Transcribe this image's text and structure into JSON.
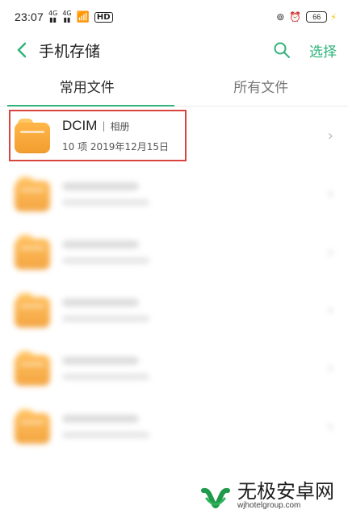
{
  "status_bar": {
    "time": "23:07",
    "signal_1": "4G",
    "signal_2": "4G",
    "network": "HD",
    "battery": "66",
    "icons": [
      "signal-icon",
      "wifi-icon",
      "alarm-icon",
      "lock-icon",
      "charging-icon"
    ]
  },
  "header": {
    "title": "手机存储",
    "select_label": "选择",
    "icons": [
      "back-icon",
      "search-icon"
    ]
  },
  "tabs": [
    {
      "label": "常用文件",
      "active": true
    },
    {
      "label": "所有文件",
      "active": false
    }
  ],
  "items": [
    {
      "name": "DCIM",
      "tag": "相册",
      "meta": "10 项  2019年12月15日",
      "highlighted": true
    }
  ],
  "watermark": {
    "cn": "无极安卓网",
    "en": "wjhotelgroup.com"
  },
  "colors": {
    "accent": "#2fb37a",
    "highlight": "#d9443f",
    "folder": "#f7a63a"
  }
}
